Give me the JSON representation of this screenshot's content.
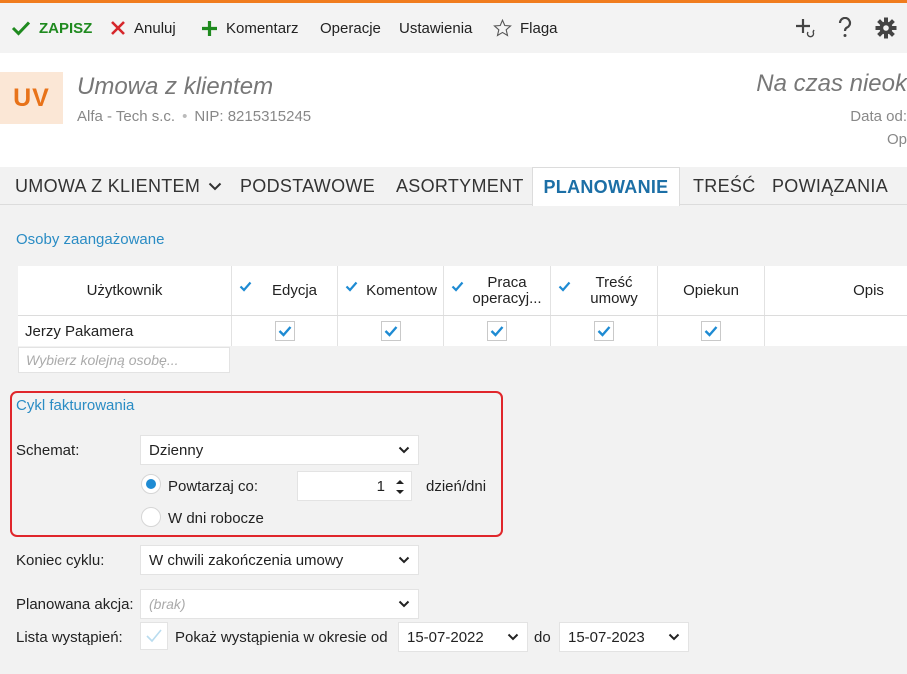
{
  "toolbar": {
    "save": "ZAPISZ",
    "cancel": "Anuluj",
    "comment": "Komentarz",
    "operations": "Operacje",
    "settings": "Ustawienia",
    "flag": "Flaga"
  },
  "header": {
    "badge": "UV",
    "title": "Umowa z klientem",
    "company": "Alfa - Tech s.c.",
    "nip": "NIP: 8215315245",
    "status": "Na czas nieok",
    "date_from_label": "Data od:",
    "op_label": "Op"
  },
  "tabs": [
    {
      "label": "UMOWA Z KLIENTEM"
    },
    {
      "label": "PODSTAWOWE"
    },
    {
      "label": "ASORTYMENT"
    },
    {
      "label": "PLANOWANIE"
    },
    {
      "label": "TREŚĆ"
    },
    {
      "label": "POWIĄZANIA"
    }
  ],
  "people": {
    "section_title": "Osoby zaangażowane",
    "columns": {
      "user": "Użytkownik",
      "edit": "Edycja",
      "comments": "Komentow",
      "work_line1": "Praca",
      "work_line2": "operacyj...",
      "content_line1": "Treść",
      "content_line2": "umowy",
      "guardian": "Opiekun",
      "description": "Opis"
    },
    "rows": [
      {
        "user": "Jerzy Pakamera",
        "edit": true,
        "comments": true,
        "work": true,
        "content": true,
        "guardian": true,
        "description": ""
      }
    ],
    "next_placeholder": "Wybierz kolejną osobę..."
  },
  "billing": {
    "section_title": "Cykl fakturowania",
    "scheme_label": "Schemat:",
    "scheme_value": "Dzienny",
    "repeat_label": "Powtarzaj co:",
    "repeat_value": "1",
    "repeat_unit": "dzień/dni",
    "workdays_label": "W dni robocze",
    "repeat_selected": true
  },
  "cycle_end": {
    "label": "Koniec cyklu:",
    "value": "W chwili zakończenia umowy"
  },
  "planned_action": {
    "label": "Planowana akcja:",
    "value": "(brak)"
  },
  "occurrences": {
    "label": "Lista wystąpień:",
    "show_label": "Pokaż wystąpienia w okresie od",
    "date_from": "15-07-2022",
    "to_label": "do",
    "date_to": "15-07-2023"
  },
  "colors": {
    "accent_orange": "#f07c1e",
    "tab_active": "#1c6fa6",
    "section_blue": "#2a8cc4",
    "check_blue": "#1e8bd3",
    "highlight_red": "#e0262b",
    "save_green": "#1f8a1f"
  }
}
